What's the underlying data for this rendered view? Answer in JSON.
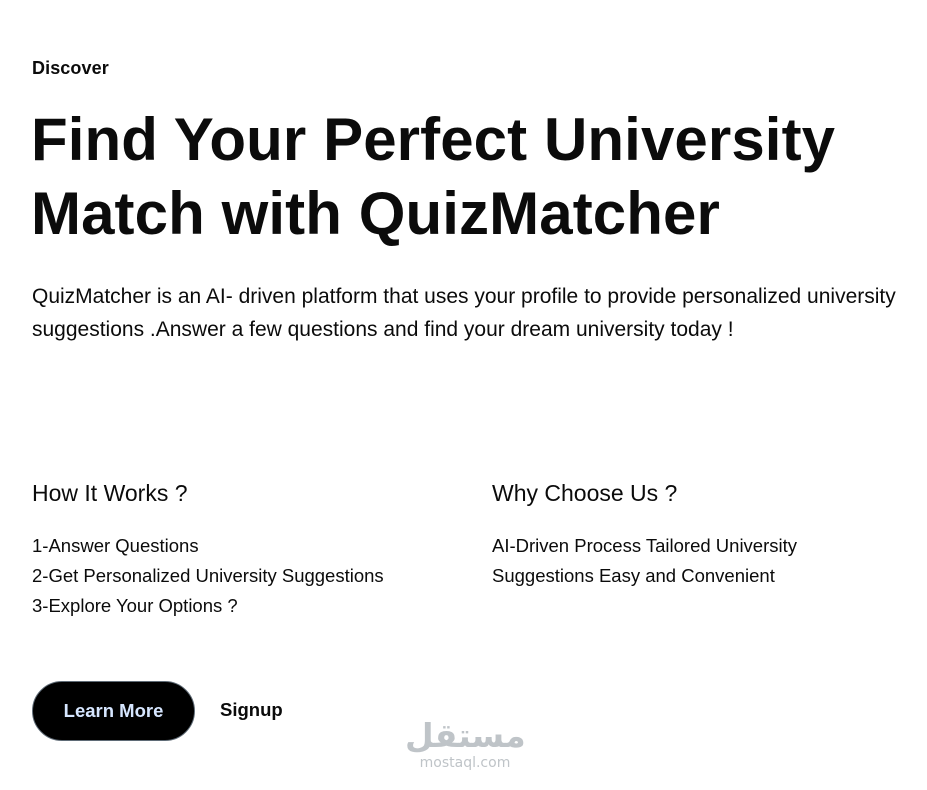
{
  "hero": {
    "eyebrow": "Discover",
    "title": "Find Your Perfect University Match with QuizMatcher",
    "description": "QuizMatcher is an AI- driven platform that uses your profile to provide personalized university suggestions .Answer a few questions and find your dream university today !"
  },
  "how_it_works": {
    "heading": "How It Works ?",
    "steps": [
      "1-Answer Questions",
      "2-Get Personalized University Suggestions",
      "3-Explore Your Options ?"
    ]
  },
  "why_choose_us": {
    "heading": "Why Choose Us ?",
    "text": "AI-Driven Process Tailored University Suggestions Easy and Convenient"
  },
  "actions": {
    "learn_more_label": "Learn More",
    "signup_label": "Signup"
  },
  "watermark": {
    "arabic": "مستقل",
    "latin": "mostaql.com"
  },
  "colors": {
    "text": "#0b0b0b",
    "button_bg": "#000000",
    "button_text": "#d6e6ff",
    "watermark": "#bfc4c8"
  }
}
